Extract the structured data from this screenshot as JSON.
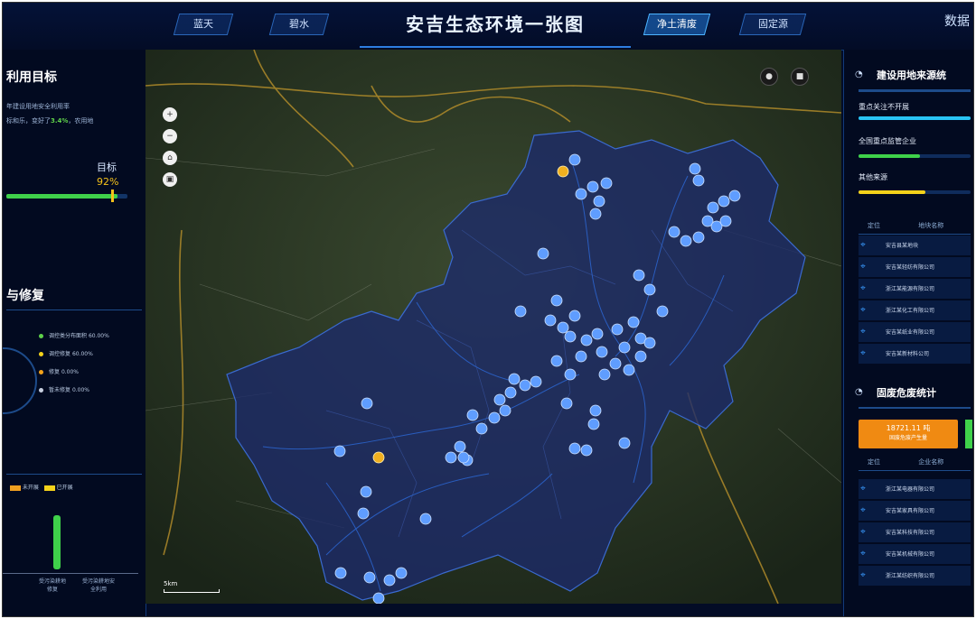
{
  "header": {
    "title": "安吉生态环境一张图",
    "tabs": [
      {
        "label": "蓝天",
        "active": false
      },
      {
        "label": "碧水",
        "active": false
      },
      {
        "label": "净土清废",
        "active": true
      },
      {
        "label": "固定源",
        "active": false
      }
    ],
    "right_label": "数据"
  },
  "left": {
    "section1_title": "利用目标",
    "line1": "年建设用地安全利用率",
    "line2_pre": "标和乐，变好了",
    "line2_val": "3.4%",
    "line2_post": "，农用地",
    "target_label": "目标",
    "target_value": "92%",
    "target_progress": 0.92,
    "section2_title": "与修复",
    "legend": [
      {
        "label": "调控类分布面积",
        "value": "60.00%",
        "color": "#5fd14a"
      },
      {
        "label": "调控修复",
        "value": "60.00%",
        "color": "#f4d21a"
      },
      {
        "label": "修复",
        "value": "0.00%",
        "color": "#f4a31a"
      },
      {
        "label": "暂未修复",
        "value": "0.00%",
        "color": "#c8d0e0"
      }
    ],
    "bottom_legend": [
      {
        "label": "未开展",
        "color": "#f0a020"
      },
      {
        "label": "已开展",
        "color": "#f4d21a"
      }
    ],
    "bar_labels": [
      "受污染耕地修复",
      "受污染耕地安全利用"
    ]
  },
  "map": {
    "controls": [
      "+",
      "−",
      "⌂",
      "▣"
    ],
    "top_buttons": [
      "●",
      "■"
    ],
    "scale_label": "5km"
  },
  "right": {
    "section1_title": "建设用地来源统",
    "bars": [
      {
        "label": "重点关注不开展",
        "value": 1.0,
        "color": "#29c4f5"
      },
      {
        "label": "全国重点监管企业",
        "value": 0.55,
        "color": "#3fd14a"
      },
      {
        "label": "其他来源",
        "value": 0.6,
        "color": "#f4d21a"
      }
    ],
    "table1_headers": [
      "定位",
      "地块名称"
    ],
    "table1_rows": [
      "安吉县某地块",
      "安吉某轻纺有限公司",
      "浙江某能源有限公司",
      "浙江某化工有限公司",
      "安吉某纸业有限公司",
      "安吉某新材料公司"
    ],
    "section2_title": "固废危废统计",
    "waste_value": "18721.11 吨",
    "waste_label": "固废危废产生量",
    "table2_headers": [
      "定位",
      "企业名称"
    ],
    "table2_rows": [
      "浙江某电器有限公司",
      "安吉某家具有限公司",
      "安吉某科技有限公司",
      "安吉某机械有限公司",
      "浙江某纺织有限公司"
    ]
  }
}
